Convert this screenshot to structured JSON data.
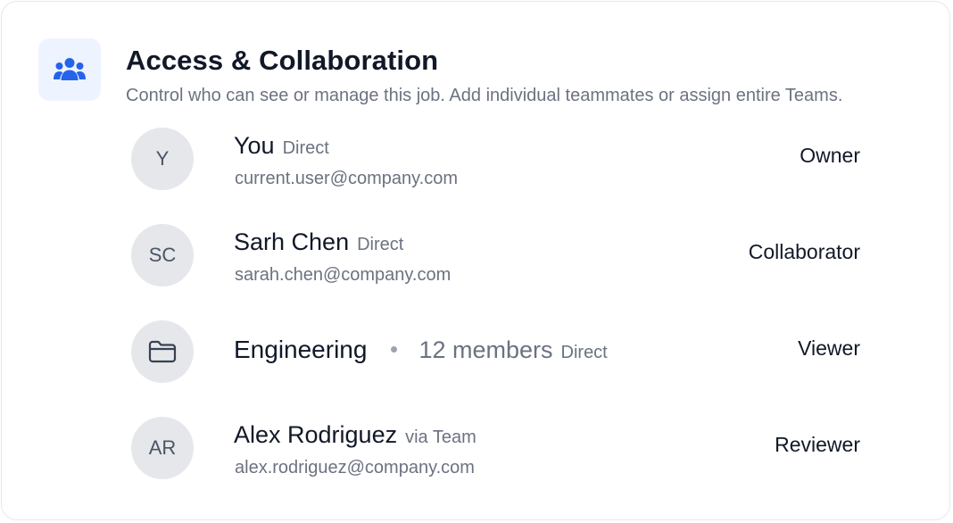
{
  "header": {
    "icon": "users-group-icon",
    "accent_color": "#2563eb",
    "title": "Access & Collaboration",
    "subtitle": "Control who can see or manage this job. Add individual teammates or assign entire Teams."
  },
  "members": [
    {
      "initials": "Y",
      "name": "You",
      "source": "Direct",
      "email": "current.user@company.com",
      "role": "Owner"
    },
    {
      "initials": "SC",
      "name": "Sarh Chen",
      "source": "Direct",
      "email": "sarah.chen@company.com",
      "role": "Collaborator"
    },
    {
      "type": "team",
      "icon": "folder-icon",
      "name": "Engineering",
      "members_count": "12 members",
      "source": "Direct",
      "role": "Viewer"
    },
    {
      "initials": "AR",
      "name": "Alex Rodriguez",
      "source": "via Team",
      "email": "alex.rodriguez@company.com",
      "role": "Reviewer"
    }
  ]
}
